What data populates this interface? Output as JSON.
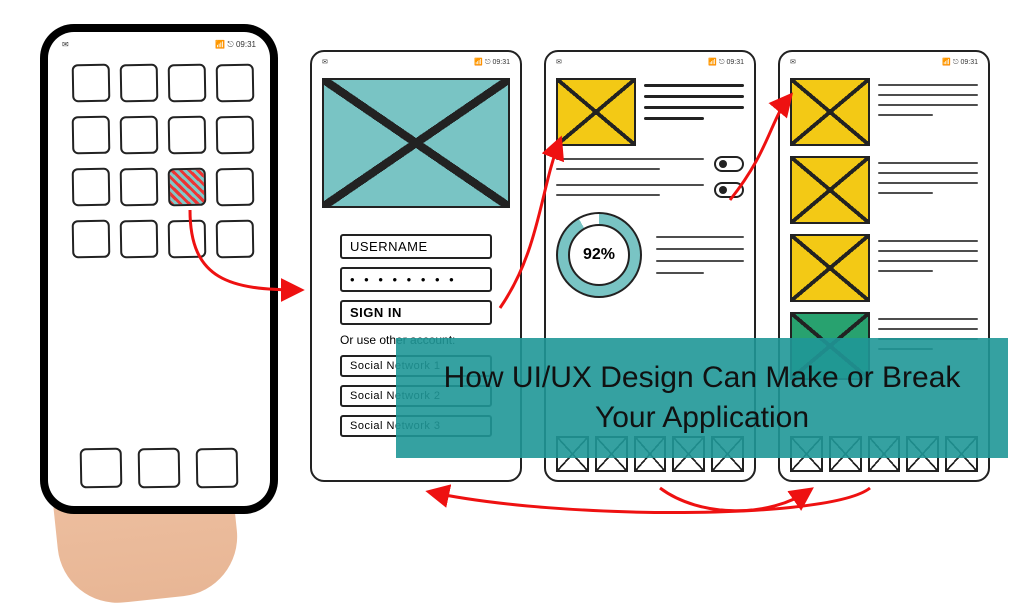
{
  "statusbar": {
    "left": "✉",
    "right": "📶 ⎋ 09:31"
  },
  "wire1": {
    "username_label": "USERNAME",
    "password_dots": "• • • • • • • •",
    "signin_label": "SIGN IN",
    "alt_label": "Or use other account:",
    "socials": [
      "Social Network 1",
      "Social Network 2",
      "Social Network 3"
    ]
  },
  "wire2": {
    "progress_label": "92%"
  },
  "overlay": {
    "title": "How UI/UX Design Can Make or Break Your Application"
  }
}
